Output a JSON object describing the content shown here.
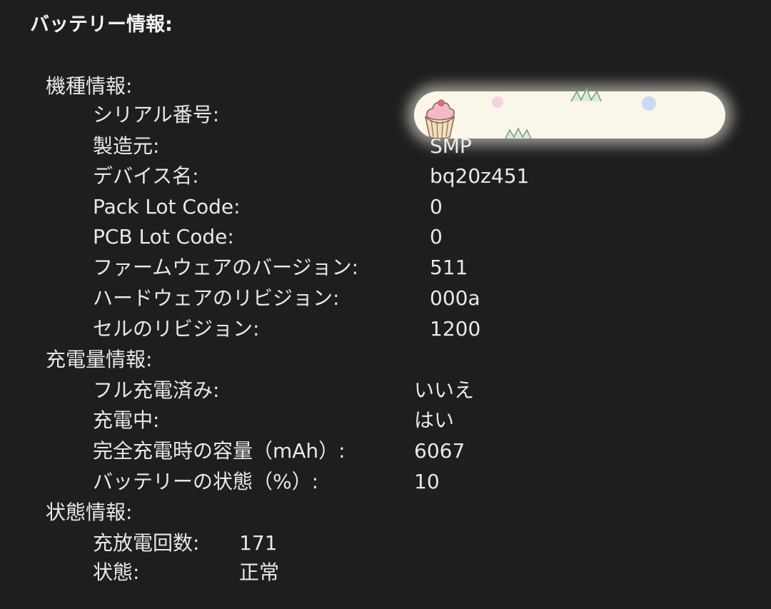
{
  "window": {
    "title": "バッテリー情報:"
  },
  "model_info": {
    "heading": "機種情報:",
    "rows": [
      {
        "label": "シリアル番号:",
        "value": ""
      },
      {
        "label": "製造元:",
        "value": "SMP"
      },
      {
        "label": "デバイス名:",
        "value": "bq20z451"
      },
      {
        "label": "Pack Lot Code:",
        "value": "0"
      },
      {
        "label": "PCB Lot Code:",
        "value": "0"
      },
      {
        "label": "ファームウェアのバージョン:",
        "value": "511"
      },
      {
        "label": "ハードウェアのリビジョン:",
        "value": "000a"
      },
      {
        "label": "セルのリビジョン:",
        "value": "1200"
      }
    ]
  },
  "charge_info": {
    "heading": "充電量情報:",
    "rows": [
      {
        "label": "フル充電済み:",
        "value": "いいえ"
      },
      {
        "label": "充電中:",
        "value": "はい"
      },
      {
        "label": "完全充電時の容量（mAh）:",
        "value": "6067"
      },
      {
        "label": "バッテリーの状態（%）:",
        "value": "10"
      }
    ]
  },
  "health_info": {
    "heading": "状態情報:",
    "rows": [
      {
        "label": "充放電回数:",
        "value": "171"
      },
      {
        "label": "状態:",
        "value": "正常"
      }
    ]
  },
  "colors": {
    "background": "#1e1e1e",
    "text": "#e8e8e8",
    "redaction": "#fbf6ea"
  }
}
